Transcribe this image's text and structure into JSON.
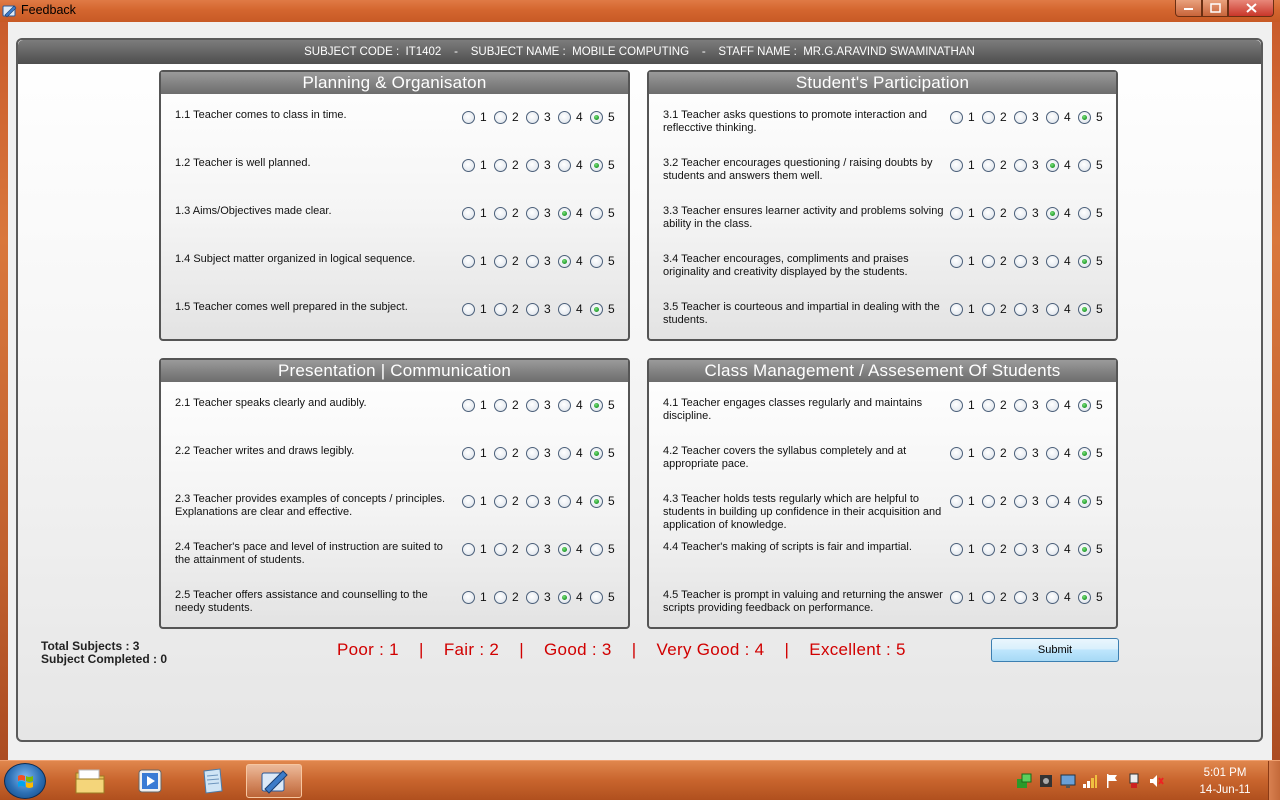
{
  "window": {
    "title": "Feedback",
    "min_icon": "minimize-icon",
    "max_icon": "maximize-icon",
    "close_icon": "close-icon"
  },
  "header": {
    "text": "SUBJECT CODE :  IT1402    -    SUBJECT NAME :  MOBILE COMPUTING    -    STAFF NAME :  MR.G.ARAVIND SWAMINATHAN"
  },
  "groups": [
    {
      "title": "Planning & Organisaton",
      "questions": [
        {
          "text": "1.1 Teacher comes to class in time.",
          "selected": 5
        },
        {
          "text": "1.2 Teacher is well planned.",
          "selected": 5
        },
        {
          "text": "1.3 Aims/Objectives made clear.",
          "selected": 4
        },
        {
          "text": "1.4 Subject matter organized in logical sequence.",
          "selected": 4
        },
        {
          "text": "1.5 Teacher comes well prepared in the subject.",
          "selected": 5
        }
      ]
    },
    {
      "title": "Student's Participation",
      "questions": [
        {
          "text": "3.1 Teacher asks questions to promote interaction and reflecctive thinking.",
          "selected": 5
        },
        {
          "text": "3.2 Teacher encourages questioning / raising doubts by students and answers them well.",
          "selected": 4
        },
        {
          "text": "3.3 Teacher ensures learner activity and problems solving ability in the class.",
          "selected": 4
        },
        {
          "text": "3.4 Teacher encourages, compliments and praises originality and creativity displayed by the students.",
          "selected": 5
        },
        {
          "text": "3.5 Teacher is courteous and impartial in dealing with the students.",
          "selected": 5
        }
      ]
    },
    {
      "title": "Presentation | Communication",
      "questions": [
        {
          "text": "2.1 Teacher speaks clearly and audibly.",
          "selected": 5
        },
        {
          "text": "2.2 Teacher writes and draws legibly.",
          "selected": 5
        },
        {
          "text": "2.3 Teacher provides examples of concepts / principles. Explanations are clear and effective.",
          "selected": 5
        },
        {
          "text": "2.4 Teacher's pace and level of instruction are suited to the attainment of students.",
          "selected": 4
        },
        {
          "text": "2.5 Teacher offers assistance and counselling to the needy students.",
          "selected": 4
        }
      ]
    },
    {
      "title": "Class Management / Assesement Of Students",
      "questions": [
        {
          "text": "4.1 Teacher engages classes regularly and maintains discipline.",
          "selected": 5
        },
        {
          "text": "4.2 Teacher covers the syllabus completely and at appropriate pace.",
          "selected": 5
        },
        {
          "text": "4.3 Teacher holds tests regularly which are helpful to students in building up confidence in their acquisition and application of knowledge.",
          "selected": 5
        },
        {
          "text": "4.4 Teacher's making of scripts is fair and impartial.",
          "selected": 5
        },
        {
          "text": "4.5 Teacher is prompt in valuing and returning the answer scripts providing feedback on performance.",
          "selected": 5
        }
      ]
    }
  ],
  "options": [
    "1",
    "2",
    "3",
    "4",
    "5"
  ],
  "totals": {
    "total_subjects": "Total Subjects :  3",
    "subject_completed": "Subject Completed :  0"
  },
  "legend": {
    "text": "Poor : 1    |    Fair : 2    |    Good : 3    |    Very Good : 4    |    Excellent : 5"
  },
  "submit": {
    "label": "Submit"
  },
  "taskbar": {
    "start_icon": "windows-start-icon",
    "pinned": [
      "folder-icon",
      "media-player-icon",
      "notepad-icon",
      "feedback-app-icon"
    ],
    "tray": [
      "network-green-icon",
      "audio-device-icon",
      "display-icon",
      "signal-icon",
      "action-center-flag-icon",
      "usb-icon",
      "volume-muted-icon"
    ],
    "clock_time": "5:01 PM",
    "clock_date": "14-Jun-11"
  },
  "colors": {
    "legend": "#d10000",
    "checked_radio": "#1f9a2a",
    "taskbar": "#c8642d"
  }
}
